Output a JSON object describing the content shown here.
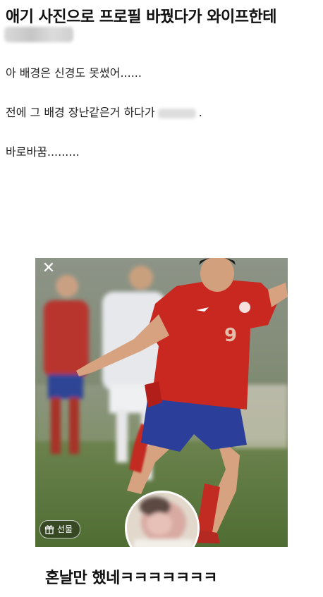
{
  "post": {
    "title": "애기 사진으로 프로필 바꿨다가 와이프한테",
    "lines": [
      "아 배경은 신경도 못썼어......",
      "전에 그 배경 장난같은거 하다가",
      "바로바꿈........."
    ],
    "line2_suffix": "."
  },
  "profile": {
    "gift_label": "선물",
    "jersey_number": "9"
  },
  "caption": "혼날만 했네ㅋㅋㅋㅋㅋㅋㅋ",
  "colors": {
    "jersey_red": "#c8281f",
    "shorts_blue": "#2a3f9a",
    "pitch_green": "#5f7a3e"
  }
}
